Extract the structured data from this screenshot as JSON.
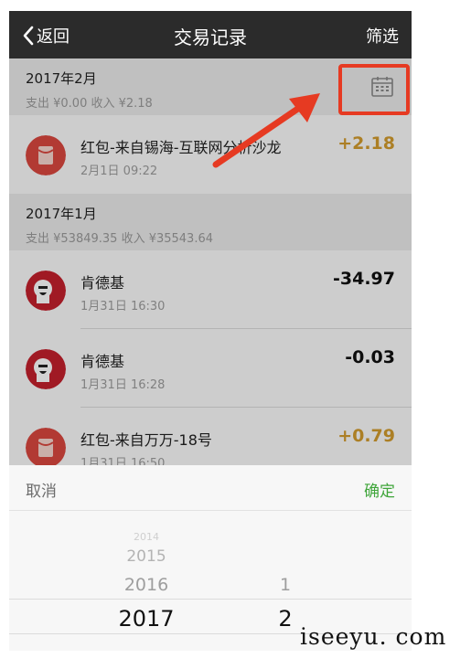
{
  "header": {
    "back_label": "返回",
    "title": "交易记录",
    "filter_label": "筛选"
  },
  "months": [
    {
      "title": "2017年2月",
      "summary": "支出 ¥0.00 收入 ¥2.18",
      "transactions": [
        {
          "name": "红包-来自锡海-互联网分析沙龙",
          "time": "2月1日 09:22",
          "amount": "+2.18",
          "type": "red-packet"
        }
      ]
    },
    {
      "title": "2017年1月",
      "summary": "支出 ¥53849.35 收入 ¥35543.64",
      "transactions": [
        {
          "name": "肯德基",
          "time": "1月31日 16:30",
          "amount": "-34.97",
          "type": "kfc"
        },
        {
          "name": "肯德基",
          "time": "1月31日 16:28",
          "amount": "-0.03",
          "type": "kfc"
        },
        {
          "name": "红包-来自万万-18号",
          "time": "1月31日 16:50",
          "amount": "+0.79",
          "type": "red-packet"
        }
      ]
    }
  ],
  "picker": {
    "cancel_label": "取消",
    "confirm_label": "确定",
    "years": [
      "2014",
      "2015",
      "2016",
      "2017"
    ],
    "months": [
      "1",
      "2"
    ],
    "selected_year": "2017",
    "selected_month": "2"
  },
  "watermark": "iseeyu. com",
  "colors": {
    "positive": "#d29b2e",
    "confirm": "#3fa53a",
    "highlight": "#e63a22",
    "red_packet": "#d9473f",
    "kfc_red": "#c4202d"
  }
}
